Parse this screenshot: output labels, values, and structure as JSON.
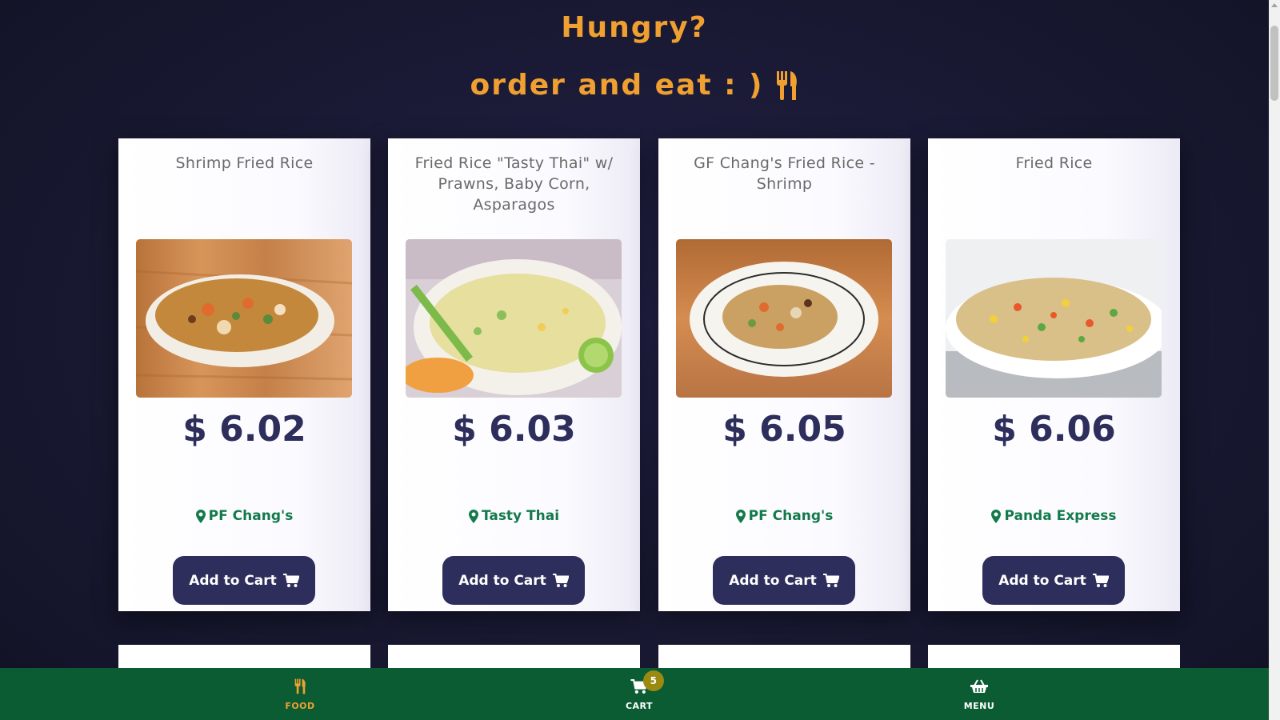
{
  "header": {
    "title": "Hungry?",
    "subtitle": "order and eat : )",
    "subtitle_icon": "utensils-icon"
  },
  "products": [
    {
      "name": "Shrimp Fried Rice",
      "price": "$ 6.02",
      "location": "PF Chang's",
      "button": "Add to Cart"
    },
    {
      "name": "Fried Rice \"Tasty Thai\" w/ Prawns, Baby Corn, Asparagos",
      "price": "$ 6.03",
      "location": "Tasty Thai",
      "button": "Add to Cart"
    },
    {
      "name": "GF Chang's Fried Rice - Shrimp",
      "price": "$ 6.05",
      "location": "PF Chang's",
      "button": "Add to Cart"
    },
    {
      "name": "Fried Rice",
      "price": "$ 6.06",
      "location": "Panda Express",
      "button": "Add to Cart"
    }
  ],
  "nav": {
    "food": {
      "label": "FOOD",
      "icon": "utensils-icon"
    },
    "cart": {
      "label": "CART",
      "icon": "cart-icon",
      "count": "5"
    },
    "menu": {
      "label": "MENU",
      "icon": "basket-icon"
    }
  },
  "colors": {
    "accent": "#f0a030",
    "primary": "#2e2e5c",
    "location": "#137a4a",
    "nav_bg": "#0b5b33",
    "background": "#1b1b35"
  }
}
